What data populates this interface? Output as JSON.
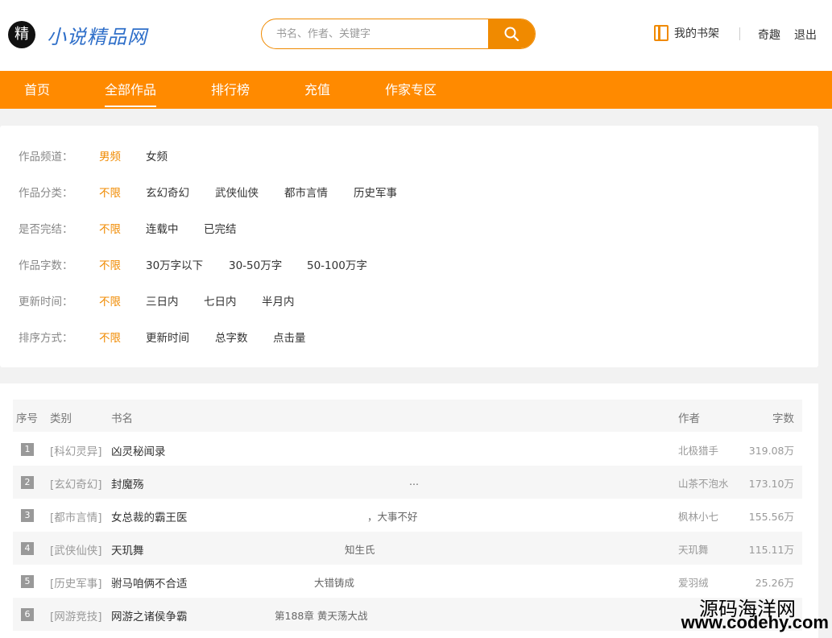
{
  "header": {
    "logo_mark": "精",
    "logo_text": "小说精品网",
    "search_placeholder": "书名、作者、关键字",
    "shelf_label": "我的书架",
    "user_name": "奇趣",
    "logout_label": "退出"
  },
  "nav": {
    "items": [
      {
        "label": "首页"
      },
      {
        "label": "全部作品"
      },
      {
        "label": "排行榜"
      },
      {
        "label": "充值"
      },
      {
        "label": "作家专区"
      }
    ],
    "active": "全部作品"
  },
  "filters": [
    {
      "label": "作品频道：",
      "options": [
        "男频",
        "女频"
      ],
      "selected": "男频"
    },
    {
      "label": "作品分类：",
      "options": [
        "不限",
        "玄幻奇幻",
        "武侠仙侠",
        "都市言情",
        "历史军事"
      ],
      "selected": "不限"
    },
    {
      "label": "是否完结：",
      "options": [
        "不限",
        "连载中",
        "已完结"
      ],
      "selected": "不限"
    },
    {
      "label": "作品字数：",
      "options": [
        "不限",
        "30万字以下",
        "30-50万字",
        "50-100万字"
      ],
      "selected": "不限"
    },
    {
      "label": "更新时间：",
      "options": [
        "不限",
        "三日内",
        "七日内",
        "半月内"
      ],
      "selected": "不限"
    },
    {
      "label": "排序方式：",
      "options": [
        "不限",
        "更新时间",
        "总字数",
        "点击量"
      ],
      "selected": "不限"
    }
  ],
  "table": {
    "headers": {
      "rank": "序号",
      "type": "类别",
      "title": "书名",
      "author": "作者",
      "words": "字数"
    },
    "rows": [
      {
        "rank": "1",
        "type": "[科幻灵异]",
        "title": "凶灵秘闻录",
        "chapter": "",
        "author": "北极猎手",
        "words": "319.08万"
      },
      {
        "rank": "2",
        "type": "[玄幻奇幻]",
        "title": "封魔殇",
        "chapter": "...",
        "author": "山茶不泡水",
        "words": "173.10万"
      },
      {
        "rank": "3",
        "type": "[都市言情]",
        "title": "女总裁的霸王医",
        "chapter": "，大事不好",
        "author": "枫林小七",
        "words": "155.56万"
      },
      {
        "rank": "4",
        "type": "[武侠仙侠]",
        "title": "天玑舞",
        "chapter": "知生氏",
        "author": "天玑舞",
        "words": "115.11万"
      },
      {
        "rank": "5",
        "type": "[历史军事]",
        "title": "驸马咱俩不合适",
        "chapter": "大错铸成",
        "author": "爱羽绒",
        "words": "25.26万"
      },
      {
        "rank": "6",
        "type": "[网游竞技]",
        "title": "网游之诸侯争霸",
        "chapter": "第188章 黄天荡大战",
        "author": "",
        "words": ""
      }
    ]
  },
  "watermark": {
    "line1": "源码海洋网",
    "line2": "www.codehy.com"
  },
  "colors": {
    "accent": "#ff8a00",
    "brand_blue": "#2f6fc9",
    "rank_badge": "#999999"
  }
}
